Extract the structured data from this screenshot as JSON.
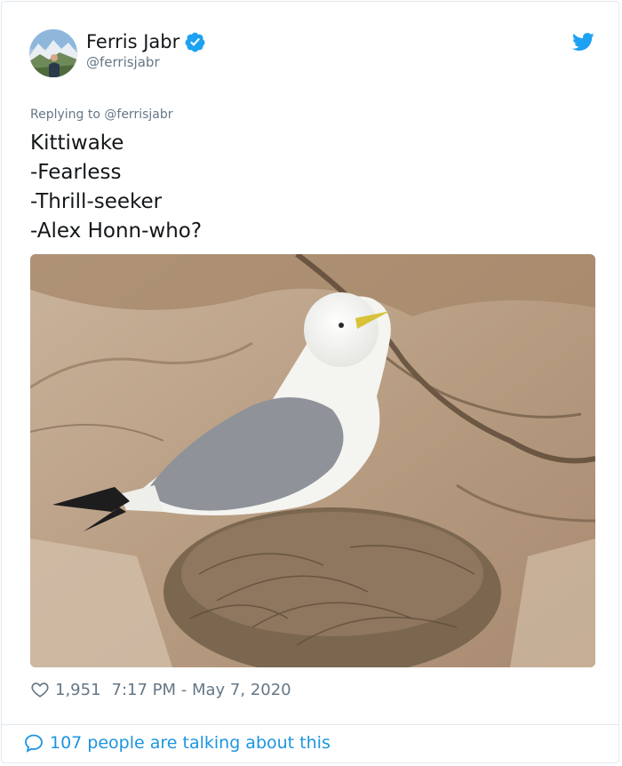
{
  "author": {
    "name": "Ferris Jabr",
    "handle": "@ferrisjabr"
  },
  "reply_prefix": "Replying to",
  "reply_to": "@ferrisjabr",
  "tweet_text": "Kittiwake\n-Fearless\n-Thrill-seeker\n-Alex Honn-who?",
  "stats": {
    "likes": "1,951",
    "timestamp": "7:17 PM - May 7, 2020"
  },
  "conversation_link": "107 people are talking about this",
  "colors": {
    "twitter_blue": "#1da1f2",
    "link_blue": "#1b95e0",
    "meta_gray": "#657786",
    "text": "#14171a"
  },
  "icons": {
    "verified": "verified-badge-icon",
    "logo": "twitter-bird-icon",
    "like": "heart-icon",
    "reply": "speech-bubble-icon"
  }
}
